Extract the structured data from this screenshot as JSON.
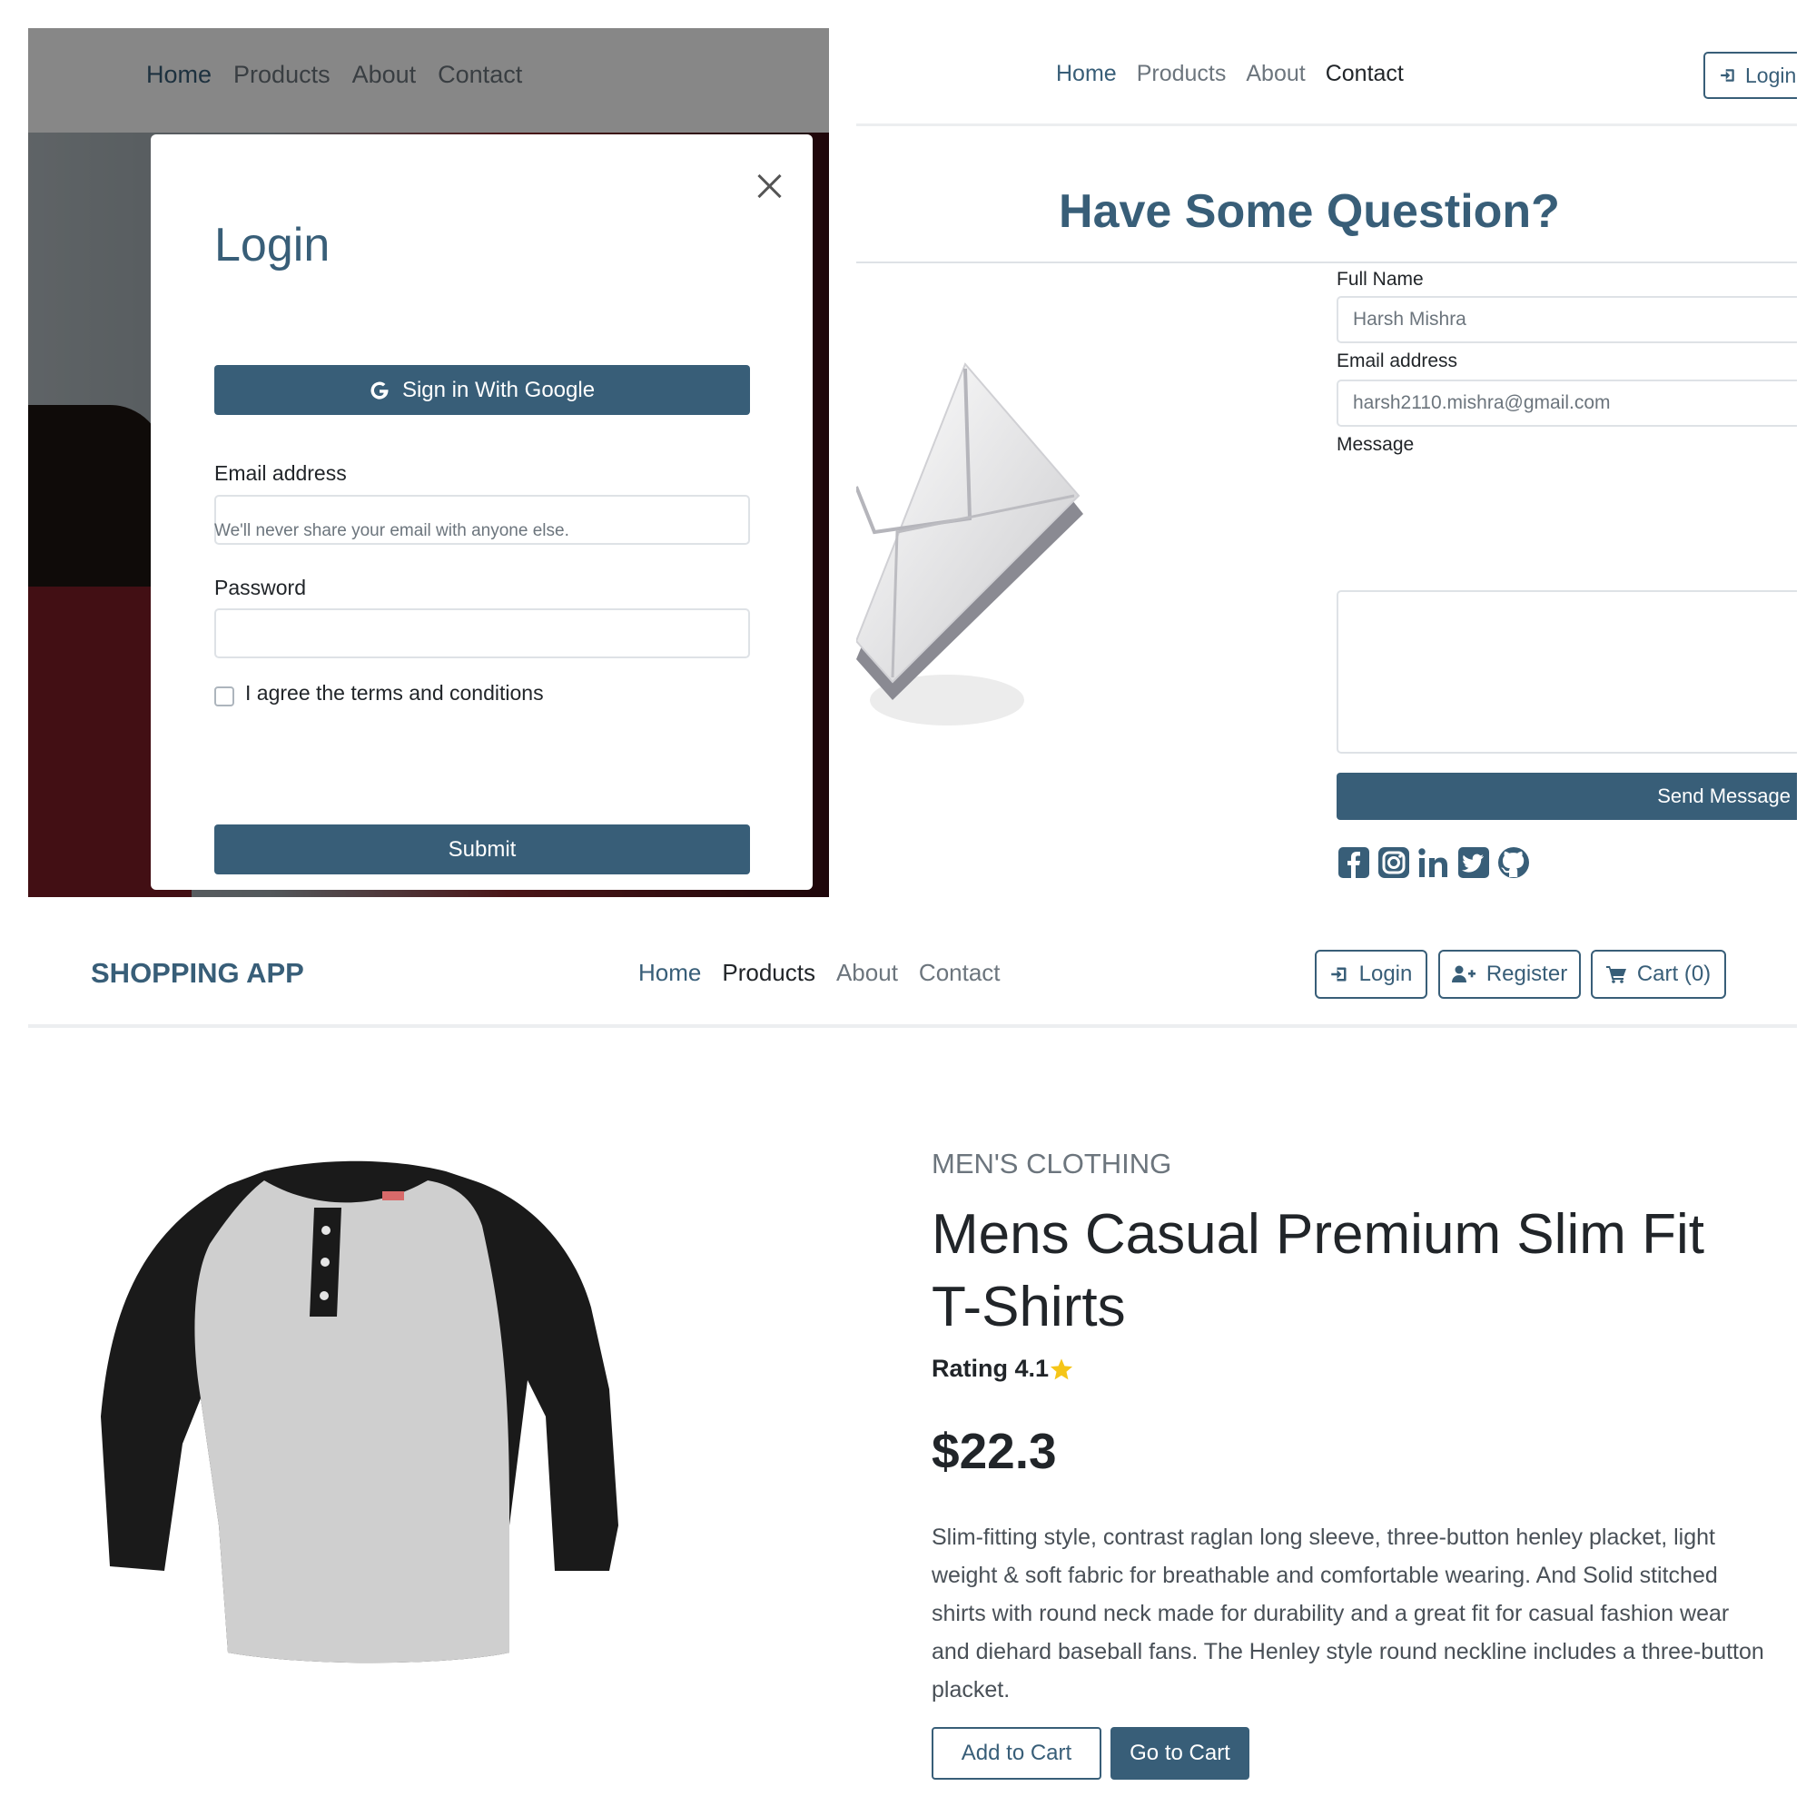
{
  "colors": {
    "primary": "#385e78",
    "muted": "#6c757d",
    "text": "#212529",
    "border": "#dee2e6",
    "star": "#f5c518"
  },
  "login_panel": {
    "nav": [
      "Home",
      "Products",
      "About",
      "Contact"
    ],
    "modal": {
      "title": "Login",
      "google_button": "Sign in With Google",
      "email_label": "Email address",
      "email_value": "",
      "email_help": "We'll never share your email with anyone else.",
      "password_label": "Password",
      "password_value": "",
      "terms_label": "I agree the terms and conditions",
      "terms_checked": false,
      "submit_button": "Submit"
    }
  },
  "contact_panel": {
    "nav": [
      "Home",
      "Products",
      "About",
      "Contact"
    ],
    "login_button": "Login",
    "heading": "Have Some Question?",
    "form": {
      "name_label": "Full Name",
      "name_placeholder": "Harsh Mishra",
      "email_label": "Email address",
      "email_placeholder": "harsh2110.mishra@gmail.com",
      "message_label": "Message",
      "send_button": "Send Message"
    },
    "social_icons": [
      "facebook-icon",
      "instagram-icon",
      "linkedin-icon",
      "twitter-icon",
      "github-icon"
    ]
  },
  "product_panel": {
    "brand": "SHOPPING APP",
    "nav": [
      "Home",
      "Products",
      "About",
      "Contact"
    ],
    "buttons": {
      "login": "Login",
      "register": "Register",
      "cart": "Cart (0)"
    },
    "product": {
      "category": "MEN'S CLOTHING",
      "title": "Mens Casual Premium Slim Fit T-Shirts",
      "rating": "Rating 4.1",
      "price": "$22.3",
      "description": "Slim-fitting style, contrast raglan long sleeve, three-button henley placket, light weight & soft fabric for breathable and comfortable wearing. And Solid stitched shirts with round neck made for durability and a great fit for casual fashion wear and diehard baseball fans. The Henley style round neckline includes a three-button placket.",
      "add_to_cart": "Add to Cart",
      "go_to_cart": "Go to Cart"
    }
  }
}
